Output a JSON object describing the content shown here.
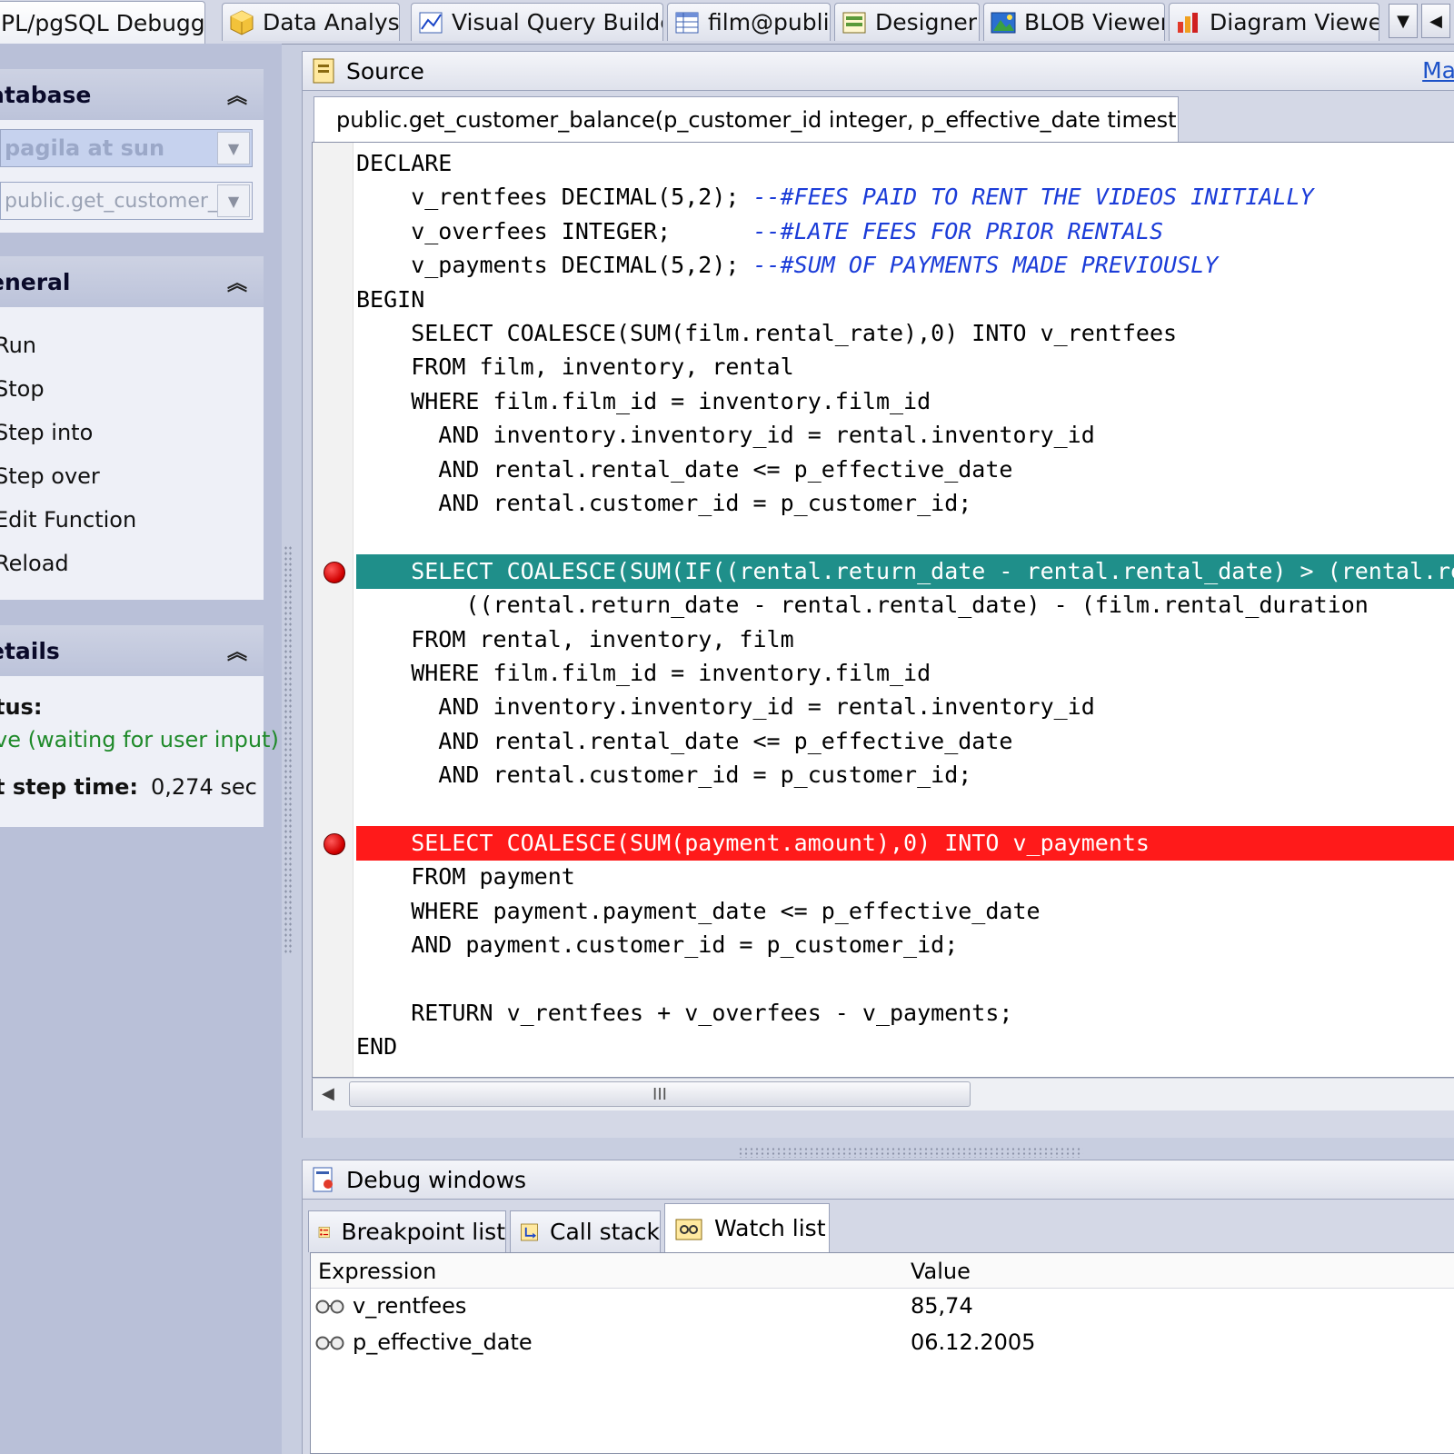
{
  "tabs": [
    {
      "label": "PL/pgSQL Debugger",
      "icon": "debugger-icon",
      "active": true
    },
    {
      "label": "Data Analysis",
      "icon": "cube-icon"
    },
    {
      "label": "Visual Query Builder",
      "icon": "query-builder-icon"
    },
    {
      "label": "film@public",
      "icon": "table-icon"
    },
    {
      "label": "Designer",
      "icon": "designer-icon"
    },
    {
      "label": "BLOB Viewer",
      "icon": "blob-viewer-icon"
    },
    {
      "label": "Diagram Viewer",
      "icon": "diagram-icon"
    }
  ],
  "sidebar": {
    "database": {
      "title": "atabase",
      "connection": "pagila at sun",
      "function": "public.get_customer_b"
    },
    "general": {
      "title": "eneral",
      "actions": [
        "Run",
        "Stop",
        "Step into",
        "Step over",
        "Edit Function",
        "Reload"
      ]
    },
    "details": {
      "title": "etails",
      "status_label": "tus:",
      "status_value": "ve (waiting for user input)",
      "step_label": "t step time:",
      "step_value": "0,274 sec"
    }
  },
  "source": {
    "title": "Source",
    "max_link": "Ma",
    "doc_tab": "public.get_customer_balance(p_customer_id integer, p_effective_date timestamp)",
    "lines": [
      "DECLARE",
      "    v_rentfees DECIMAL(5,2); ",
      "    v_overfees INTEGER;      ",
      "    v_payments DECIMAL(5,2); ",
      "BEGIN",
      "    SELECT COALESCE(SUM(film.rental_rate),0) INTO v_rentfees",
      "    FROM film, inventory, rental",
      "    WHERE film.film_id = inventory.film_id",
      "      AND inventory.inventory_id = rental.inventory_id",
      "      AND rental.rental_date <= p_effective_date",
      "      AND rental.customer_id = p_customer_id;",
      "",
      "    SELECT COALESCE(SUM(IF((rental.return_date - rental.rental_date) > (rental.return_date",
      "        ((rental.return_date - rental.rental_date) - (film.rental_duration",
      "    FROM rental, inventory, film",
      "    WHERE film.film_id = inventory.film_id",
      "      AND inventory.inventory_id = rental.inventory_id",
      "      AND rental.rental_date <= p_effective_date",
      "      AND rental.customer_id = p_customer_id;",
      "",
      "    SELECT COALESCE(SUM(payment.amount),0) INTO v_payments",
      "    FROM payment",
      "    WHERE payment.payment_date <= p_effective_date",
      "    AND payment.customer_id = p_customer_id;",
      "",
      "    RETURN v_rentfees + v_overfees - v_payments;",
      "END"
    ],
    "comments": [
      "--#FEES PAID TO RENT THE VIDEOS INITIALLY",
      "--#LATE FEES FOR PRIOR RENTALS",
      "--#SUM OF PAYMENTS MADE PREVIOUSLY"
    ],
    "exec_line": 12,
    "breakpoint_lines": [
      12,
      20
    ],
    "scroll_thumb": "III"
  },
  "debug": {
    "title": "Debug windows",
    "tabs": [
      {
        "label": "Breakpoint list",
        "icon": "breakpoint-list-icon"
      },
      {
        "label": "Call stack",
        "icon": "call-stack-icon"
      },
      {
        "label": "Watch list",
        "icon": "watch-list-icon",
        "active": true
      }
    ],
    "watch": {
      "col_expression": "Expression",
      "col_value": "Value",
      "rows": [
        {
          "expression": "v_rentfees",
          "value": "85,74"
        },
        {
          "expression": "p_effective_date",
          "value": "06.12.2005"
        }
      ]
    }
  },
  "colors": {
    "exec_highlight": "#1f8f8a",
    "breakpoint_highlight": "#ff1a1a",
    "comment": "#1b3cd8",
    "status_green": "#1f8a2a"
  }
}
